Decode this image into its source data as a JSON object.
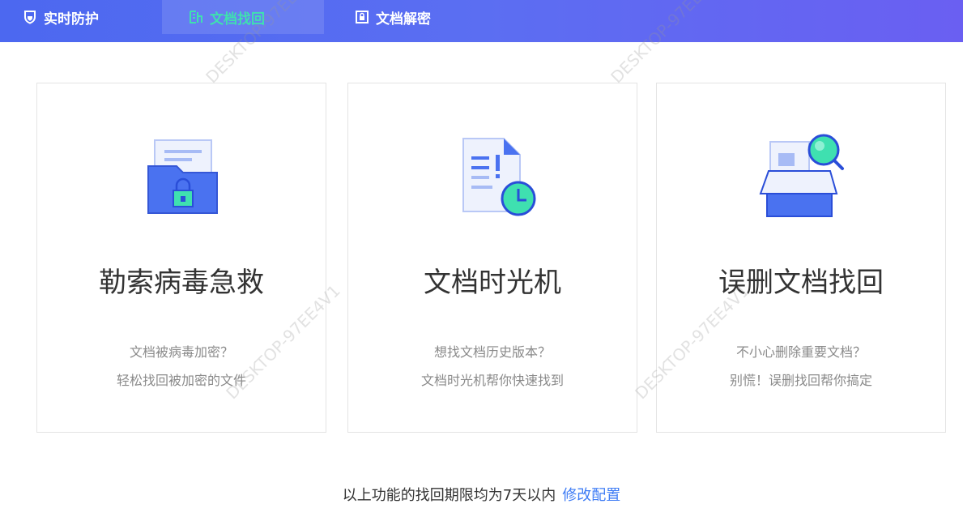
{
  "tabs": [
    {
      "label": "实时防护",
      "icon": "shield-icon",
      "active": false
    },
    {
      "label": "文档找回",
      "icon": "document-restore-icon",
      "active": true
    },
    {
      "label": "文档解密",
      "icon": "lock-icon",
      "active": false
    }
  ],
  "cards": [
    {
      "title": "勒索病毒急救",
      "line1": "文档被病毒加密？",
      "line2": "轻松找回被加密的文件",
      "icon": "locked-folder-icon"
    },
    {
      "title": "文档时光机",
      "line1": "想找文档历史版本？",
      "line2": "文档时光机帮你快速找到",
      "icon": "document-clock-icon"
    },
    {
      "title": "误删文档找回",
      "line1": "不小心删除重要文档？",
      "line2": "别慌！误删找回帮你搞定",
      "icon": "box-search-icon"
    }
  ],
  "footer": {
    "text": "以上功能的找回期限均为7天以内",
    "link": "修改配置"
  },
  "watermark": "DESKTOP-97EE4V1",
  "colors": {
    "header": "#5a6cf2",
    "accent": "#3e7cf5",
    "icon_blue": "#4a72f0",
    "icon_green": "#3fe0b0"
  }
}
